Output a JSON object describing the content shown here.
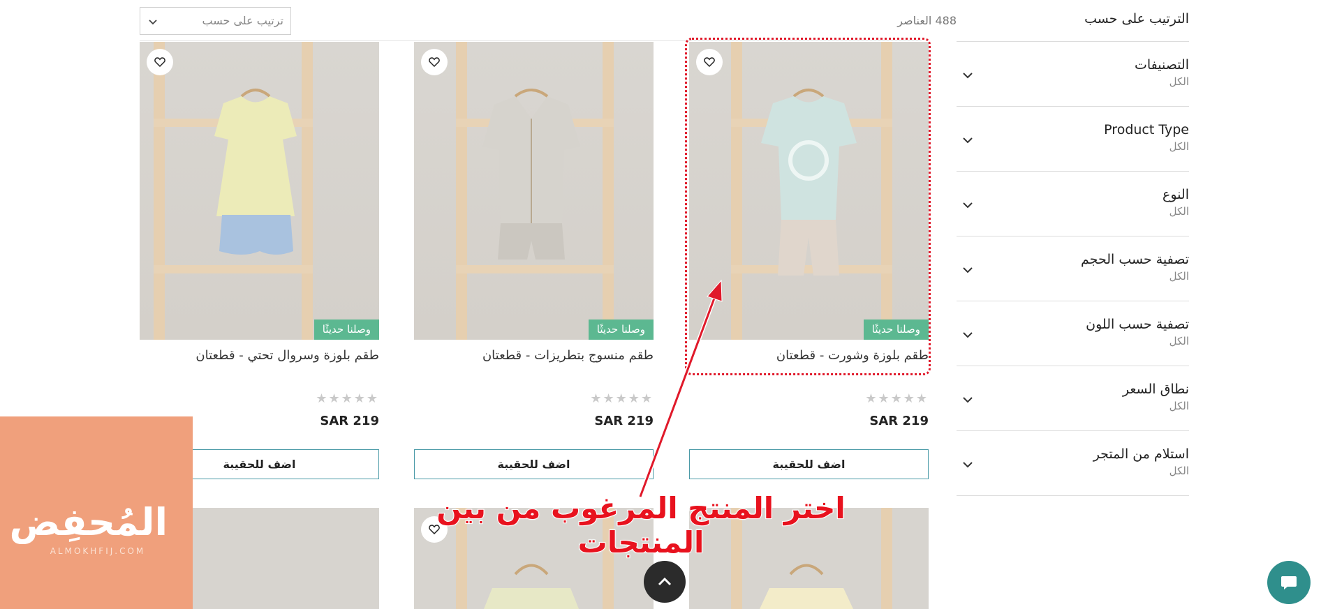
{
  "sidebar": {
    "sort_title": "الترتيب على حسب",
    "filters": [
      {
        "title": "التصنيفات",
        "value": "الكل"
      },
      {
        "title": "Product Type",
        "value": "الكل"
      },
      {
        "title": "النوع",
        "value": "الكل"
      },
      {
        "title": "تصفية حسب الحجم",
        "value": "الكل"
      },
      {
        "title": "تصفية حسب اللون",
        "value": "الكل"
      },
      {
        "title": "نطاق السعر",
        "value": "الكل"
      },
      {
        "title": "استلام من المتجر",
        "value": "الكل"
      }
    ]
  },
  "toolbar": {
    "count": "488 العناصر",
    "sort_placeholder": "ترتيب على حسب"
  },
  "products": [
    {
      "name": "طقم بلوزة وشورت - قطعتان",
      "badge": "وصلنا حديثًا",
      "rating": "★★★★★",
      "price": "SAR 219",
      "add_label": "اضف للحقيبة"
    },
    {
      "name": "طقم منسوج بتطريزات - قطعتان",
      "badge": "وصلنا حديثًا",
      "rating": "★★★★★",
      "price": "SAR 219",
      "add_label": "اضف للحقيبة"
    },
    {
      "name": "طقم بلوزة وسروال تحتي - قطعتان",
      "badge": "وصلنا حديثًا",
      "rating": "★★★★★",
      "price": "SAR 219",
      "add_label": "اضف للحقيبة"
    }
  ],
  "annotation": {
    "text": "اختر المنتج المرغوب من بين المنتجات",
    "color": "#e8121e"
  },
  "watermark": {
    "logo": "المُحفِض",
    "subtitle": "ALMOKHFIJ.COM"
  },
  "colors": {
    "badge": "#5cb891",
    "button_border": "#4a9aa7",
    "chat": "#2f8f8c",
    "highlight": "#e0192a"
  },
  "icons": {
    "wishlist": "heart-icon",
    "dropdown": "chevron-down-icon",
    "scroll_top": "chevron-up-icon",
    "chat": "chat-bubble-icon"
  }
}
